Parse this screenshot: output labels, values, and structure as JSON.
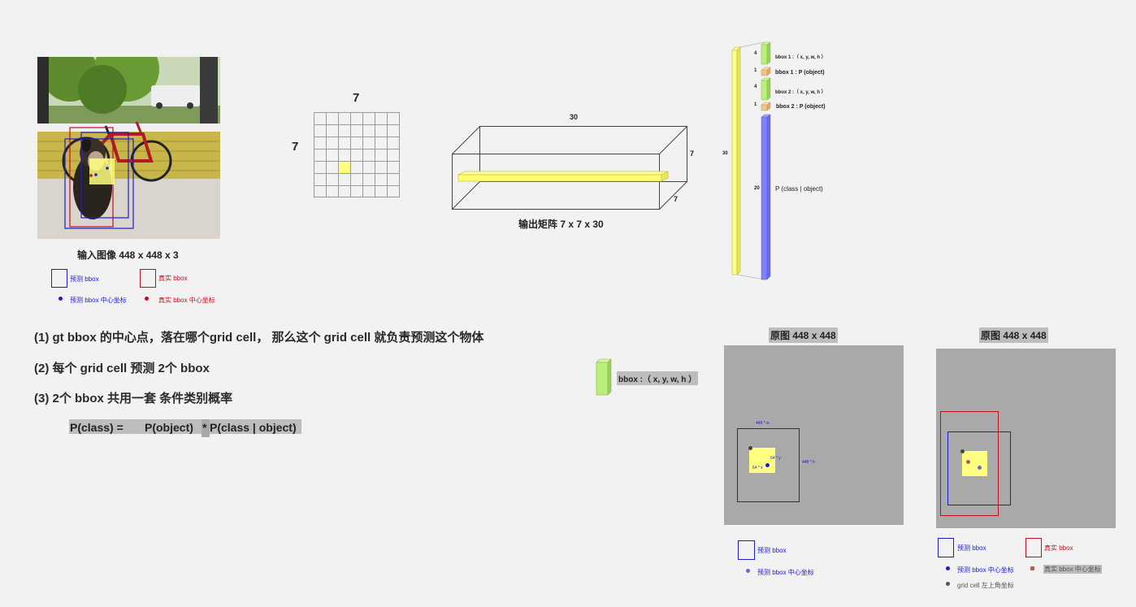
{
  "input_image": {
    "caption": "输入图像 448 x 448 x 3"
  },
  "legend_main": {
    "pred_bbox": "预测 bbox",
    "gt_bbox": "真实 bbox",
    "pred_center": "预测 bbox 中心坐标",
    "gt_center": "真实 bbox 中心坐标"
  },
  "grid": {
    "top_label": "7",
    "left_label": "7"
  },
  "tensor": {
    "top_label": "30",
    "right_label": "7",
    "depth_label": "7",
    "caption": "输出矩阵 7 x 7 x 30"
  },
  "vector": {
    "length_label": "30",
    "segments": [
      {
        "size": "4",
        "label": "bbox 1 :（ x, y, w, h ）"
      },
      {
        "size": "1",
        "label": "bbox 1 : P (object)"
      },
      {
        "size": "4",
        "label": "bbox 2 :（ x, y, w, h ）"
      },
      {
        "size": "1",
        "label": "bbox 2 : P (object)"
      },
      {
        "size": "20",
        "label": "P (class | object)"
      }
    ]
  },
  "notes": {
    "n1": "(1)  gt bbox 的中心点，落在哪个grid cell， 那么这个 grid cell 就负责预测这个物体",
    "n2": "(2)  每个 grid cell 预测 2个 bbox",
    "n3": "(3)  2个 bbox 共用一套 条件类别概率",
    "formula_lhs": "P(class) =",
    "formula_p_object": "P(object)",
    "formula_op": "*",
    "formula_cond": "P(class | object)"
  },
  "bbox_legend_block": {
    "label": "bbox :（ x, y, w, h ）"
  },
  "panel1": {
    "title": "原图 448 x 448",
    "w_label": "448 * w",
    "h_label": "448 * h",
    "x_label": "64 * x",
    "y_label": "64 * y",
    "legend_pred_bbox": "预测 bbox",
    "legend_pred_center": "预测 bbox 中心坐标"
  },
  "panel2": {
    "title": "原图 448 x 448",
    "legend_pred_bbox": "预测 bbox",
    "legend_gt_bbox": "真实 bbox",
    "legend_pred_center": "预测 bbox 中心坐标",
    "legend_gt_center": "真实 bbox 中心坐标",
    "legend_cell_corner": "grid cell 左上角坐标"
  },
  "colors": {
    "pred": "#1d1dd0",
    "gt": "#c0101e",
    "cell_yellow": "#ffff80",
    "bbox_green": "#b8f07a",
    "pobj_orange": "#f5c48a",
    "class_purple": "#8080ff",
    "panel_grey": "#a9a9a9"
  }
}
